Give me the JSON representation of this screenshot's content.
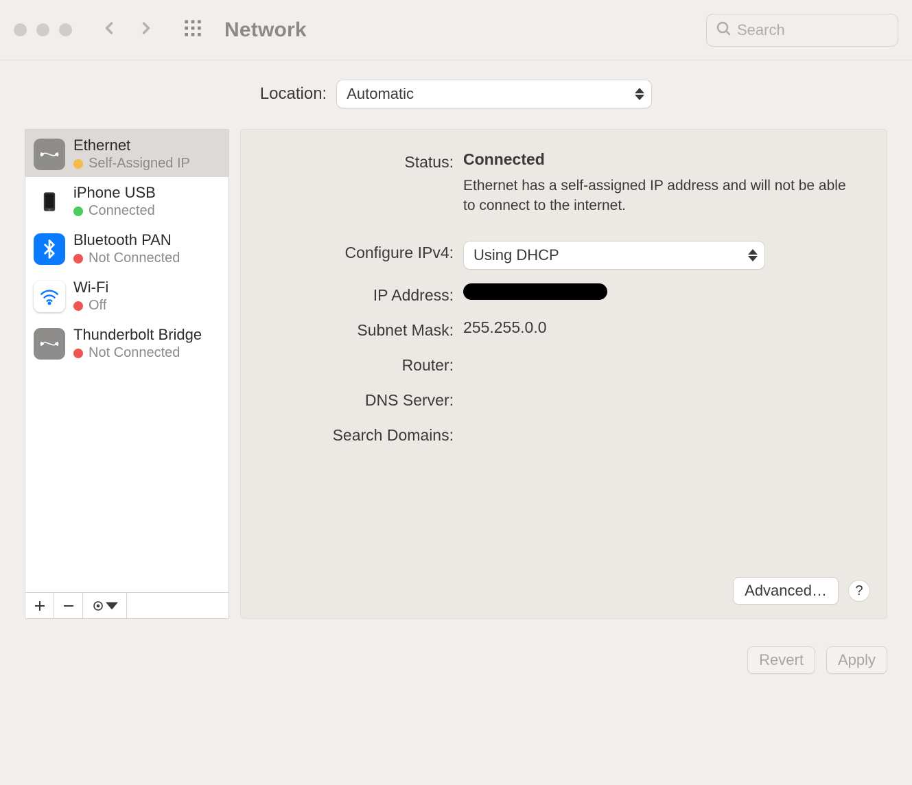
{
  "window": {
    "title": "Network",
    "search_placeholder": "Search"
  },
  "location": {
    "label": "Location:",
    "value": "Automatic"
  },
  "services": [
    {
      "name": "Ethernet",
      "status_text": "Self-Assigned IP",
      "status_color": "orange",
      "icon": "ethernet",
      "selected": true
    },
    {
      "name": "iPhone USB",
      "status_text": "Connected",
      "status_color": "green",
      "icon": "iphone",
      "selected": false
    },
    {
      "name": "Bluetooth PAN",
      "status_text": "Not Connected",
      "status_color": "red",
      "icon": "bluetooth",
      "selected": false
    },
    {
      "name": "Wi-Fi",
      "status_text": "Off",
      "status_color": "red",
      "icon": "wifi",
      "selected": false
    },
    {
      "name": "Thunderbolt Bridge",
      "status_text": "Not Connected",
      "status_color": "red",
      "icon": "ethernet",
      "selected": false
    }
  ],
  "details": {
    "status_label": "Status:",
    "status_value": "Connected",
    "status_description": "Ethernet has a self-assigned IP address and will not be able to connect to the internet.",
    "configure_label": "Configure IPv4:",
    "configure_value": "Using DHCP",
    "ip_label": "IP Address:",
    "subnet_label": "Subnet Mask:",
    "subnet_value": "255.255.0.0",
    "router_label": "Router:",
    "router_value": "",
    "dns_label": "DNS Server:",
    "dns_value": "",
    "domains_label": "Search Domains:",
    "domains_value": "",
    "advanced_btn": "Advanced…",
    "help_btn": "?"
  },
  "footer": {
    "revert": "Revert",
    "apply": "Apply"
  }
}
